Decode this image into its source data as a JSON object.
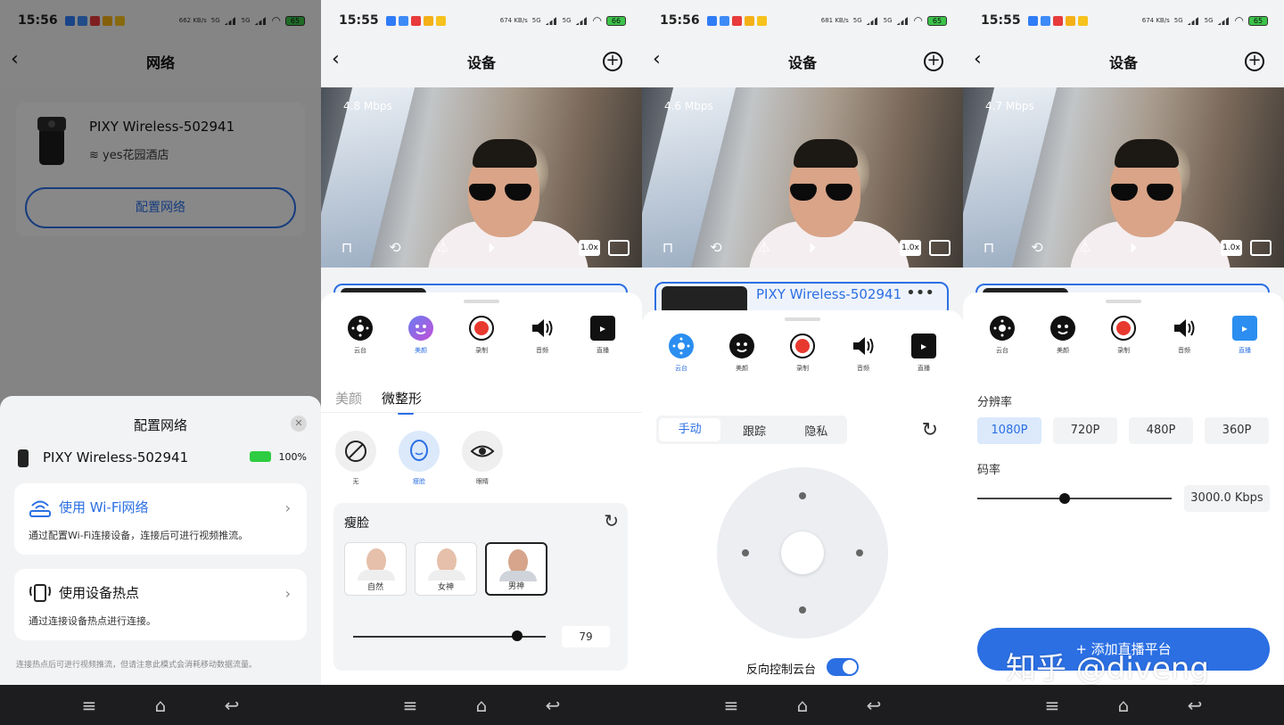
{
  "phone1": {
    "status": {
      "time": "15:56",
      "net_speed": "662 KB/s",
      "sig1": "5G",
      "sig2": "5G",
      "battery": "65"
    },
    "nav_title": "网络",
    "device_name": "PIXY Wireless-502941",
    "ssid": "yes花园酒店",
    "config_button": "配置网络",
    "modal": {
      "title": "配置网络",
      "device_name": "PIXY Wireless-502941",
      "battery": "100%",
      "wifi_title": "使用 Wi-Fi网络",
      "wifi_desc": "通过配置Wi-Fi连接设备，连接后可进行视频推流。",
      "hotspot_title": "使用设备热点",
      "hotspot_desc": "通过连接设备热点进行连接。",
      "note": "连接热点后可进行视频推流，但请注意此模式会消耗移动数据流量。"
    }
  },
  "phone2": {
    "status": {
      "time": "15:55",
      "net_speed": "674 KB/s",
      "sig1": "5G",
      "sig2": "5G",
      "battery": "66"
    },
    "nav_title": "设备",
    "bitrate": "4.8 Mbps",
    "zoom": "1.0x",
    "tools": [
      {
        "label": "云台"
      },
      {
        "label": "美颜"
      },
      {
        "label": "录制"
      },
      {
        "label": "音频"
      },
      {
        "label": "直播"
      }
    ],
    "tab_beauty": "美颜",
    "tab_shape": "微整形",
    "effects": [
      {
        "label": "无"
      },
      {
        "label": "瘦脸"
      },
      {
        "label": "眼睛"
      }
    ],
    "panel_title": "瘦脸",
    "presets": [
      {
        "label": "自然"
      },
      {
        "label": "女神"
      },
      {
        "label": "男神"
      }
    ],
    "slider_value": "79",
    "slider_level": 0.85
  },
  "phone3": {
    "status": {
      "time": "15:56",
      "net_speed": "681 KB/s",
      "sig1": "5G",
      "sig2": "5G",
      "battery": "65"
    },
    "nav_title": "设备",
    "bitrate": "4.6 Mbps",
    "zoom": "1.0x",
    "device_name": "PIXY Wireless-502941",
    "more": "•••",
    "tools": [
      {
        "label": "云台"
      },
      {
        "label": "美颜"
      },
      {
        "label": "录制"
      },
      {
        "label": "音频"
      },
      {
        "label": "直播"
      }
    ],
    "modes": [
      "手动",
      "跟踪",
      "隐私"
    ],
    "reverse_label": "反向控制云台"
  },
  "phone4": {
    "status": {
      "time": "15:55",
      "net_speed": "674 KB/s",
      "sig1": "5G",
      "sig2": "5G",
      "battery": "65"
    },
    "nav_title": "设备",
    "bitrate": "4.7 Mbps",
    "zoom": "1.0x",
    "tools": [
      {
        "label": "云台"
      },
      {
        "label": "美颜"
      },
      {
        "label": "录制"
      },
      {
        "label": "音频"
      },
      {
        "label": "直播"
      }
    ],
    "resolution_label": "分辨率",
    "resolutions": [
      "1080P",
      "720P",
      "480P",
      "360P"
    ],
    "bitrate_label": "码率",
    "bitrate_value": "3000.0 Kbps",
    "bitrate_level": 0.45,
    "add_button": "+ 添加直播平台"
  },
  "watermark": "知乎 @diveng",
  "colors": {
    "accent": "#2b6fe3",
    "record": "#e8392f",
    "battery": "#2ecc40"
  }
}
